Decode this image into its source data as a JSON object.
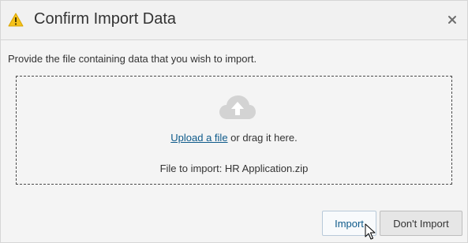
{
  "dialog": {
    "title": "Confirm Import Data",
    "title_icon": "warning-icon",
    "close_icon": "close-icon",
    "accent_color": "#0e5a8a",
    "warning_color": "#f5c21b"
  },
  "body": {
    "instructions": "Provide the file containing data that you wish to import.",
    "dropzone": {
      "icon": "cloud-upload-icon",
      "upload_link": "Upload a file",
      "upload_suffix": " or drag it here.",
      "file_label": "File to import: HR Application.zip"
    }
  },
  "footer": {
    "import_label": "Import",
    "dont_import_label": "Don't Import"
  }
}
